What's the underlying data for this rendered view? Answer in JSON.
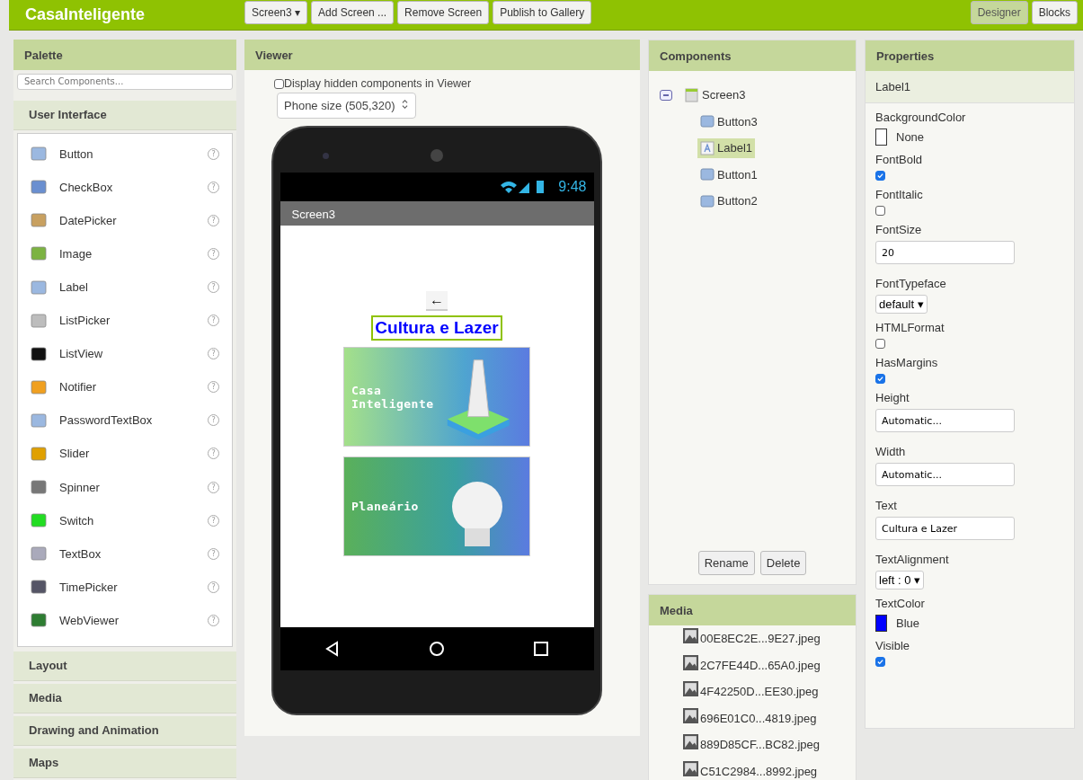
{
  "topbar": {
    "app_name": "CasaInteligente",
    "buttons": [
      {
        "label": "Screen3 ▾"
      },
      {
        "label": "Add Screen ..."
      },
      {
        "label": "Remove Screen"
      },
      {
        "label": "Publish to Gallery"
      }
    ],
    "modes": [
      {
        "label": "Designer",
        "selected": true
      },
      {
        "label": "Blocks",
        "selected": false
      }
    ]
  },
  "palette": {
    "title": "Palette",
    "search_placeholder": "Search Components...",
    "groups": [
      {
        "label": "User Interface",
        "items": [
          {
            "name": "Button",
            "help": "?"
          },
          {
            "name": "CheckBox",
            "help": "?"
          },
          {
            "name": "DatePicker",
            "help": "?"
          },
          {
            "name": "Image",
            "help": "?"
          },
          {
            "name": "Label",
            "help": "?"
          },
          {
            "name": "ListPicker",
            "help": "?"
          },
          {
            "name": "ListView",
            "help": "?"
          },
          {
            "name": "Notifier",
            "help": "?"
          },
          {
            "name": "PasswordTextBox",
            "help": "?"
          },
          {
            "name": "Slider",
            "help": "?"
          },
          {
            "name": "Spinner",
            "help": "?"
          },
          {
            "name": "Switch",
            "help": "?"
          },
          {
            "name": "TextBox",
            "help": "?"
          },
          {
            "name": "TimePicker",
            "help": "?"
          },
          {
            "name": "WebViewer",
            "help": "?"
          }
        ]
      },
      {
        "label": "Layout"
      },
      {
        "label": "Media"
      },
      {
        "label": "Drawing and Animation"
      },
      {
        "label": "Maps"
      }
    ]
  },
  "viewer": {
    "title": "Viewer",
    "hidden_checkbox": {
      "label": "Display hidden components in Viewer",
      "checked": false
    },
    "size_select": "Phone size (505,320)",
    "phone": {
      "time": "9:48",
      "screen_title": "Screen3",
      "back_button": "←",
      "label_text": "Cultura e Lazer",
      "image_buttons": [
        {
          "text": "Casa\nInteligente",
          "kind": "tower"
        },
        {
          "text": "Planeário",
          "kind": "dome"
        }
      ]
    }
  },
  "components": {
    "title": "Components",
    "root": {
      "name": "Screen3",
      "children": [
        {
          "name": "Button3",
          "kind": "button",
          "selected": false
        },
        {
          "name": "Label1",
          "kind": "label",
          "selected": true
        },
        {
          "name": "Button1",
          "kind": "button",
          "selected": false
        },
        {
          "name": "Button2",
          "kind": "button",
          "selected": false
        }
      ]
    },
    "buttons": [
      "Rename",
      "Delete"
    ]
  },
  "media": {
    "title": "Media",
    "files": [
      "00E8EC2E...9E27.jpeg",
      "2C7FE44D...65A0.jpeg",
      "4F42250D...EE30.jpeg",
      "696E01C0...4819.jpeg",
      "889D85CF...BC82.jpeg",
      "C51C2984...8992.jpeg"
    ]
  },
  "properties": {
    "title": "Properties",
    "component": "Label1",
    "items": [
      {
        "name": "BackgroundColor",
        "kind": "color",
        "value": "None",
        "color": "#ffffff"
      },
      {
        "name": "FontBold",
        "kind": "checkbox",
        "checked": true
      },
      {
        "name": "FontItalic",
        "kind": "checkbox",
        "checked": false
      },
      {
        "name": "FontSize",
        "kind": "input",
        "value": "20"
      },
      {
        "name": "FontTypeface",
        "kind": "dropdown",
        "value": "default ▾"
      },
      {
        "name": "HTMLFormat",
        "kind": "checkbox",
        "checked": false
      },
      {
        "name": "HasMargins",
        "kind": "checkbox",
        "checked": true
      },
      {
        "name": "Height",
        "kind": "input",
        "value": "Automatic..."
      },
      {
        "name": "Width",
        "kind": "input",
        "value": "Automatic..."
      },
      {
        "name": "Text",
        "kind": "input",
        "value": "Cultura e Lazer"
      },
      {
        "name": "TextAlignment",
        "kind": "dropdown",
        "value": "left : 0 ▾"
      },
      {
        "name": "TextColor",
        "kind": "color",
        "value": "Blue",
        "color": "#0000ff"
      },
      {
        "name": "Visible",
        "kind": "checkbox",
        "checked": true
      }
    ]
  }
}
